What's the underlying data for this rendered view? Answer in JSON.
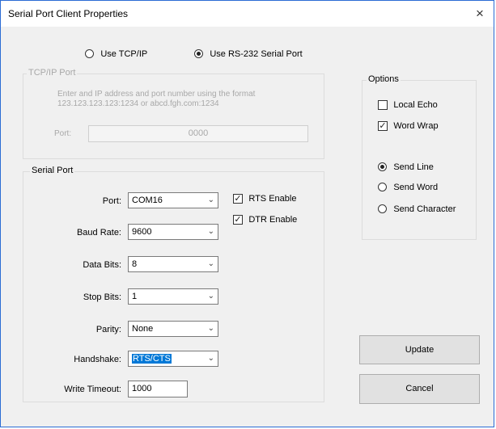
{
  "window": {
    "title": "Serial Port Client Properties",
    "close_glyph": "×"
  },
  "connection": {
    "tcp_label": "Use TCP/IP",
    "tcp_selected": false,
    "rs232_label": "Use RS-232 Serial Port",
    "rs232_selected": true
  },
  "tcp_group": {
    "title": "TCP/IP Port",
    "hint_line1": "Enter and IP address and port number using the format",
    "hint_line2": "123.123.123.123:1234 or abcd.fgh.com:1234",
    "port_label": "Port:",
    "port_value": "0000"
  },
  "serial_group": {
    "title": "Serial Port",
    "port_label": "Port:",
    "port_value": "COM16",
    "baud_label": "Baud Rate:",
    "baud_value": "9600",
    "databits_label": "Data Bits:",
    "databits_value": "8",
    "stopbits_label": "Stop Bits:",
    "stopbits_value": "1",
    "parity_label": "Parity:",
    "parity_value": "None",
    "handshake_label": "Handshake:",
    "handshake_value": "RTS/CTS",
    "timeout_label": "Write Timeout:",
    "timeout_value": "1000",
    "rts_label": "RTS Enable",
    "rts_checked": true,
    "dtr_label": "DTR Enable",
    "dtr_checked": true
  },
  "options_group": {
    "title": "Options",
    "local_echo_label": "Local Echo",
    "local_echo_checked": false,
    "word_wrap_label": "Word Wrap",
    "word_wrap_checked": true,
    "send_line_label": "Send Line",
    "send_line_selected": true,
    "send_word_label": "Send Word",
    "send_word_selected": false,
    "send_char_label": "Send Character",
    "send_char_selected": false
  },
  "buttons": {
    "update_label": "Update",
    "cancel_label": "Cancel"
  },
  "icons": {
    "dropdown_arrow": "chevron-down-icon",
    "check_mark": "checkmark-icon"
  }
}
